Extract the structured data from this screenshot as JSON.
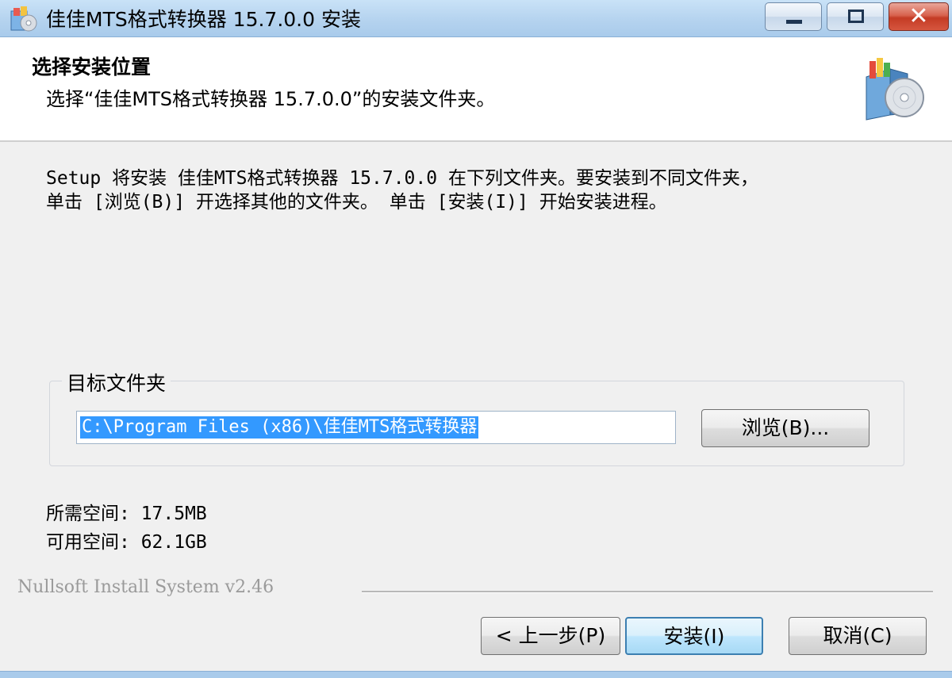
{
  "window": {
    "title": "佳佳MTS格式转换器 15.7.0.0 安装",
    "close_glyph": "✕"
  },
  "header": {
    "title": "选择安装位置",
    "subtitle": "选择“佳佳MTS格式转换器 15.7.0.0”的安装文件夹。"
  },
  "description": {
    "line1": "Setup 将安装 佳佳MTS格式转换器 15.7.0.0 在下列文件夹。要安装到不同文件夹，",
    "line2": "单击 [浏览(B)] 开选择其他的文件夹。 单击 [安装(I)] 开始安装进程。"
  },
  "destination": {
    "label": "目标文件夹",
    "path": "C:\\Program Files (x86)\\佳佳MTS格式转换器",
    "browse_label": "浏览(B)..."
  },
  "space": {
    "required": "所需空间: 17.5MB",
    "available": "可用空间: 62.1GB"
  },
  "branding": "Nullsoft Install System v2.46",
  "buttons": {
    "back": "< 上一步(P)",
    "install": "安装(I)",
    "cancel": "取消(C)"
  },
  "icons": {
    "app": "installer-app-icon",
    "header": "installer-box-disc-icon"
  }
}
